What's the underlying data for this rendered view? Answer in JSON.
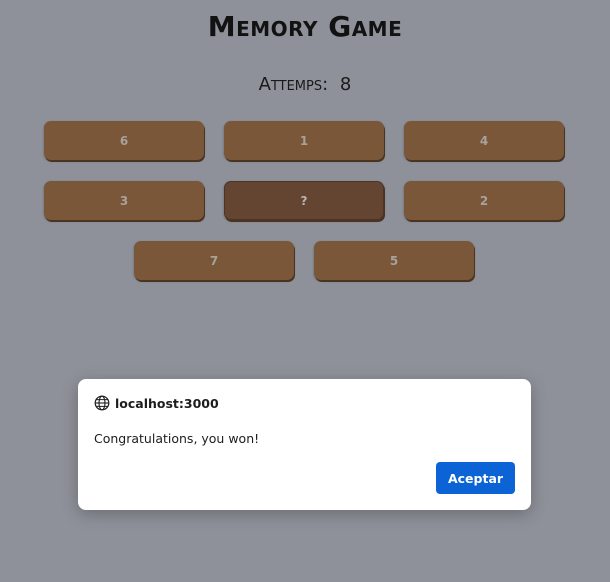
{
  "game": {
    "title": "Memory Game",
    "attempts_label": "Attemps:",
    "attempts_value": "8"
  },
  "cards": [
    {
      "label": "6",
      "state": "revealed"
    },
    {
      "label": "1",
      "state": "revealed"
    },
    {
      "label": "4",
      "state": "revealed"
    },
    {
      "label": "3",
      "state": "revealed"
    },
    {
      "label": "?",
      "state": "hidden"
    },
    {
      "label": "2",
      "state": "revealed"
    },
    {
      "label": "7",
      "state": "revealed"
    },
    {
      "label": "5",
      "state": "revealed"
    }
  ],
  "dialog": {
    "origin": "localhost:3000",
    "message": "Congratulations, you won!",
    "ok_label": "Aceptar"
  },
  "colors": {
    "background": "#8e9199",
    "card": "#7a5738",
    "card_hidden": "#634531",
    "button_accent": "#0b63d6"
  }
}
